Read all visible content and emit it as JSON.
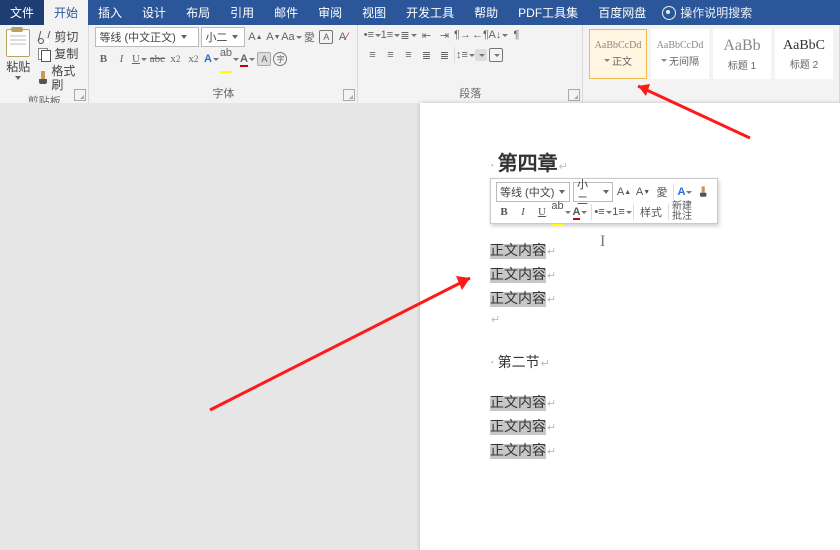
{
  "menu": {
    "file": "文件",
    "tabs": [
      "开始",
      "插入",
      "设计",
      "布局",
      "引用",
      "邮件",
      "审阅",
      "视图",
      "开发工具",
      "帮助",
      "PDF工具集",
      "百度网盘"
    ],
    "active_index": 0,
    "search_placeholder": "操作说明搜索"
  },
  "ribbon": {
    "clipboard": {
      "paste": "粘贴",
      "cut": "剪切",
      "copy": "复制",
      "format_painter": "格式刷",
      "group": "剪贴板"
    },
    "font": {
      "name": "等线 (中文正文)",
      "size": "小二",
      "group": "字体",
      "bold": "B",
      "italic": "I",
      "underline": "U"
    },
    "paragraph": {
      "group": "段落"
    },
    "styles": [
      {
        "preview": "AaBbCcDd",
        "name": "正文",
        "selected": true
      },
      {
        "preview": "AaBbCcDd",
        "name": "无间隔",
        "selected": false
      },
      {
        "preview": "AaBb",
        "name": "标题 1",
        "selected": false
      },
      {
        "preview": "AaBbC",
        "name": "标题 2",
        "selected": false
      }
    ]
  },
  "mini": {
    "font": "等线 (中文)",
    "size": "小二",
    "bold": "B",
    "italic": "I",
    "underline": "U",
    "style_btn": "样式",
    "comment_l1": "新建",
    "comment_l2": "批注"
  },
  "doc": {
    "heading": "第四章",
    "body_line": "正文内容",
    "section2": "第二节"
  }
}
